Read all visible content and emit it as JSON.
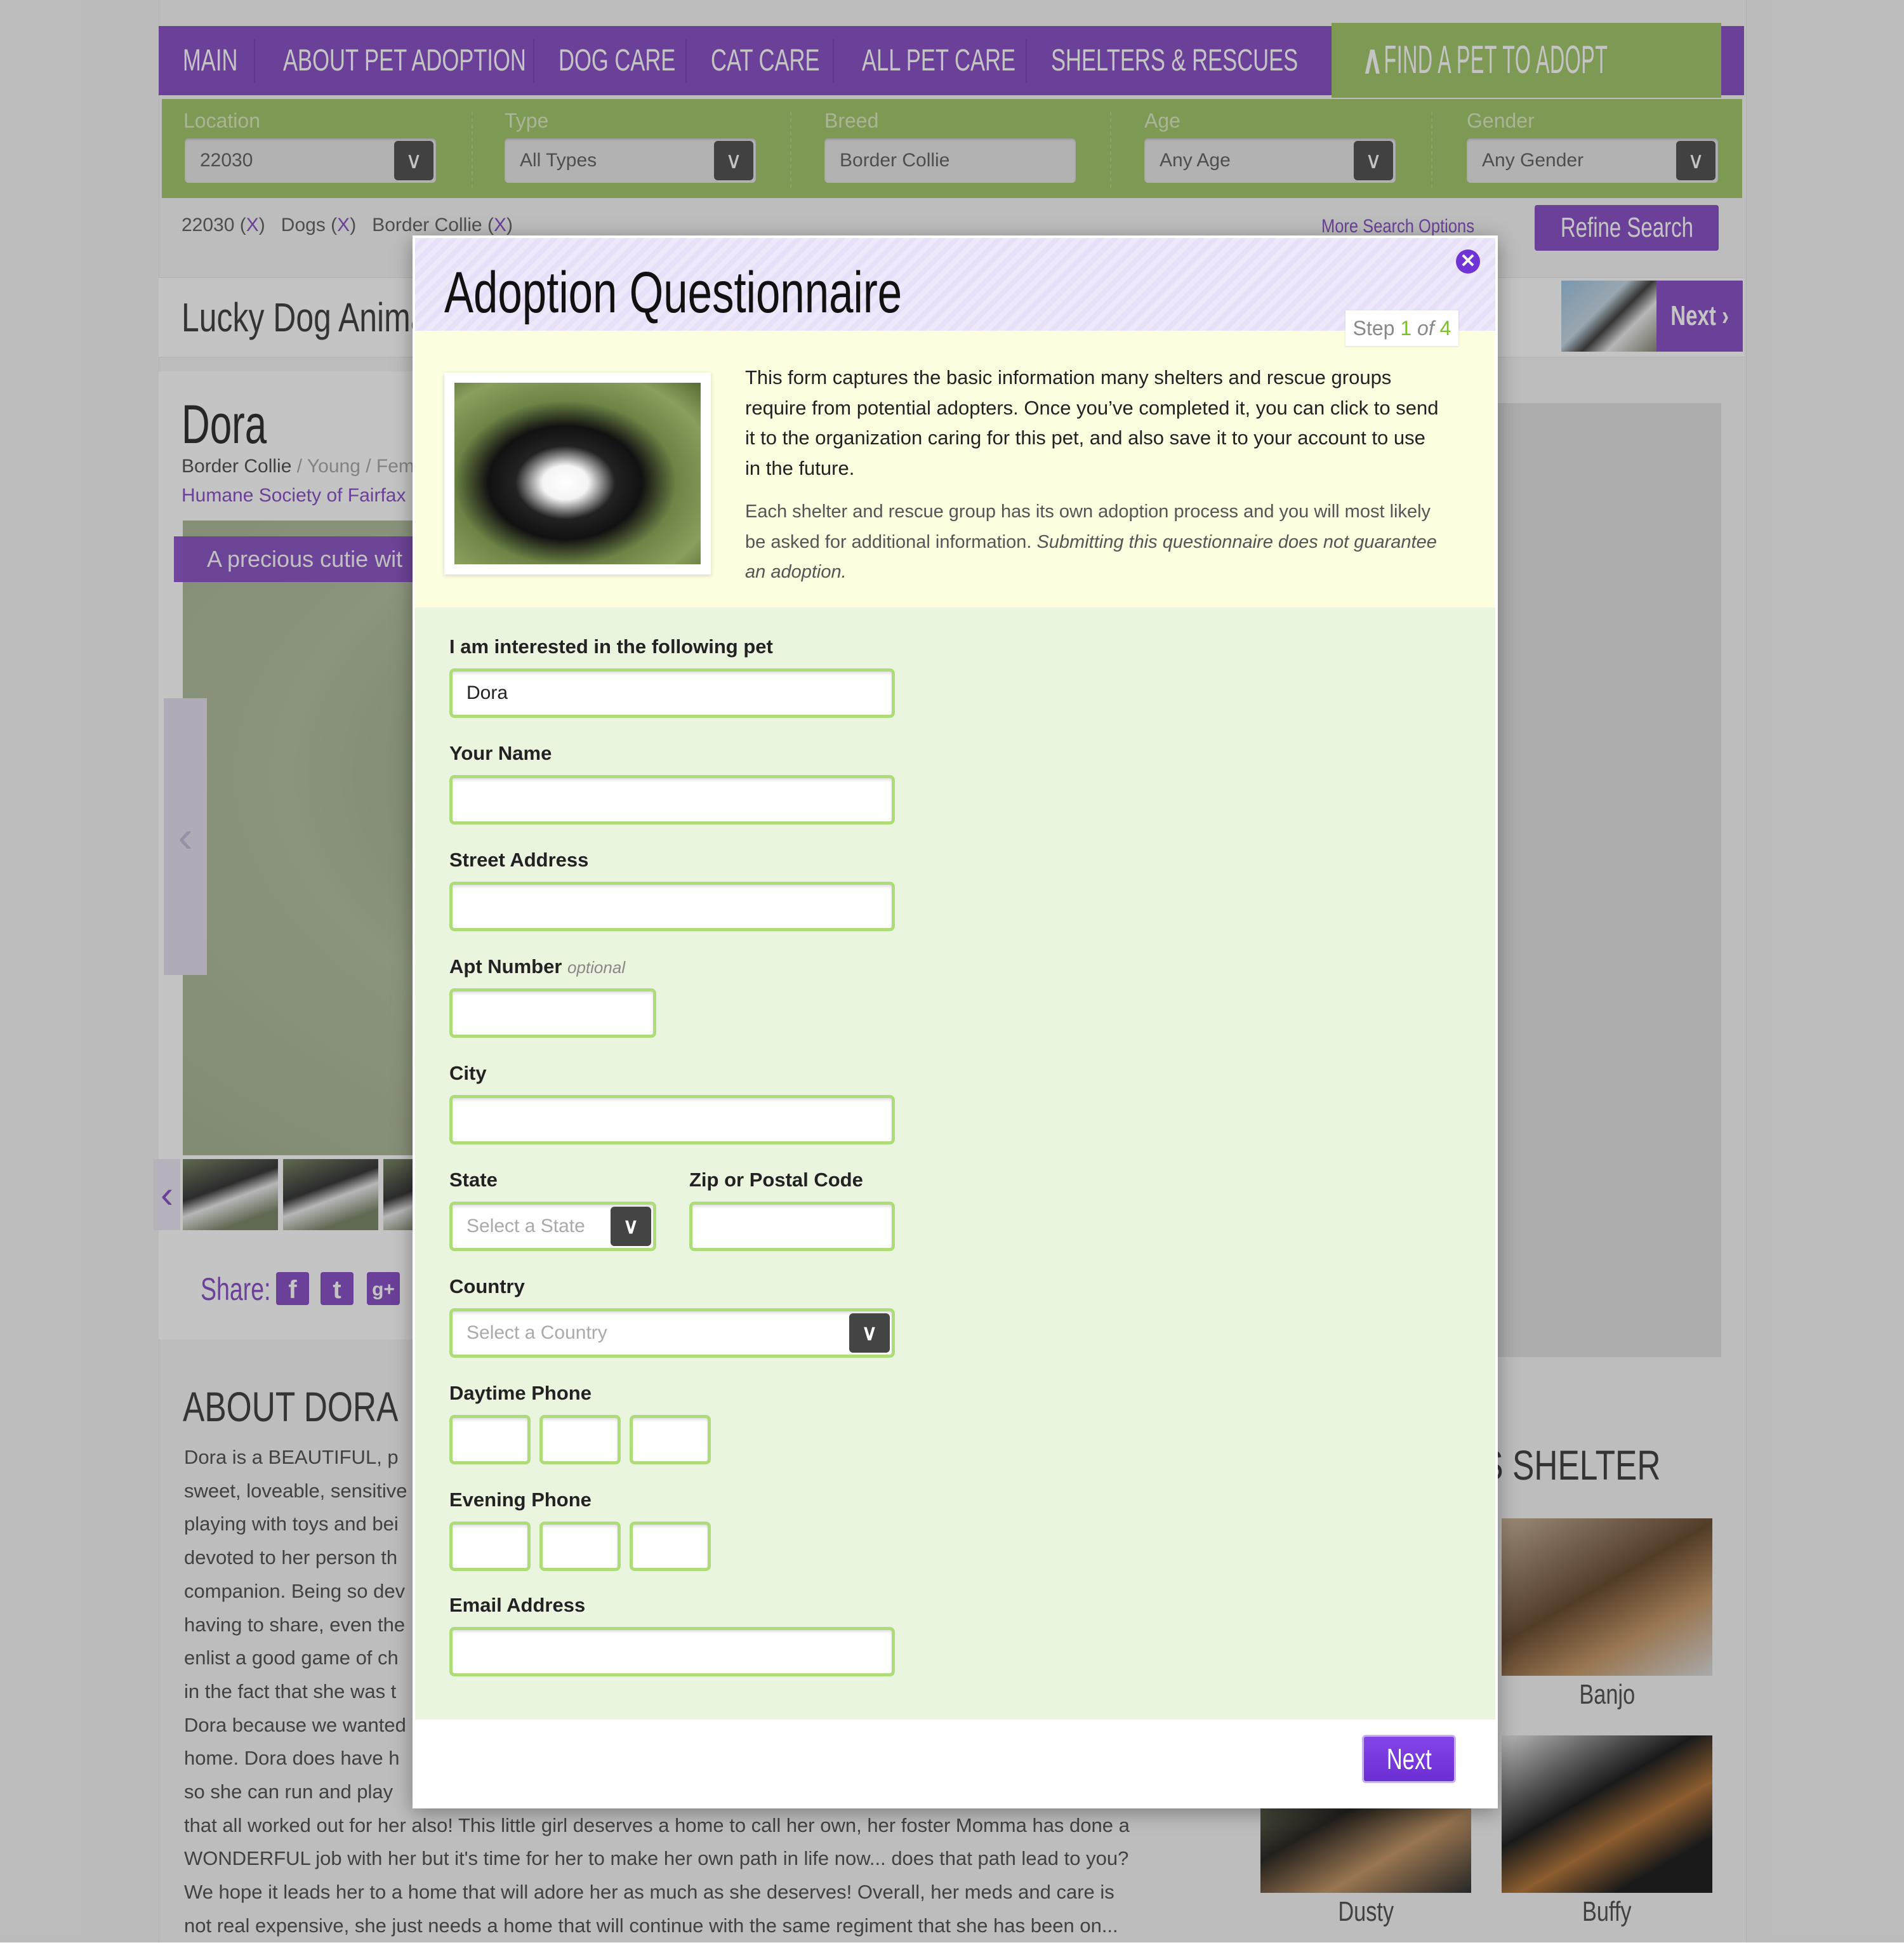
{
  "nav": {
    "items": [
      "MAIN",
      "ABOUT PET ADOPTION",
      "DOG CARE",
      "CAT CARE",
      "ALL PET CARE",
      "SHELTERS & RESCUES"
    ],
    "active_tab": "FIND A PET TO ADOPT",
    "active_tab_icon": "chevron-up-icon"
  },
  "filters": {
    "location": {
      "label": "Location",
      "value": "22030"
    },
    "type": {
      "label": "Type",
      "value": "All Types"
    },
    "breed": {
      "label": "Breed",
      "value": "Border Collie"
    },
    "age": {
      "label": "Age",
      "value": "Any Age"
    },
    "gender": {
      "label": "Gender",
      "value": "Any Gender"
    }
  },
  "applied_filters": [
    {
      "text": "22030",
      "remove": "X"
    },
    {
      "text": "Dogs",
      "remove": "X"
    },
    {
      "text": "Border Collie",
      "remove": "X"
    }
  ],
  "more_search_options": "More Search Options",
  "refine_search": "Refine Search",
  "shelter_bar": {
    "name": "Lucky Dog Animal",
    "next_label": "Next ›"
  },
  "pet": {
    "name": "Dora",
    "breed": "Border Collie",
    "meta": " / Young / Fem",
    "organization": "Humane Society of Fairfax",
    "caption": "A precious cutie wit",
    "share_label": "Share:",
    "share_icons": [
      "f",
      "t",
      "g+"
    ],
    "about_title": "ABOUT DORA",
    "about_lines": [
      "Dora is a BEAUTIFUL, p",
      "sweet, loveable, sensitive",
      "playing with toys and bei",
      "devoted to her person th",
      "companion. Being so dev",
      "having to share, even the",
      "enlist a good game of ch",
      "in the fact that she was t",
      "Dora because we wanted",
      "home. Dora does have h",
      "so she can run and play",
      "that all worked out for her also! This little girl deserves a home to call her own, her foster Momma has done a",
      "WONDERFUL job with her but it's time for her to make her own path in life now... does that path lead to you?",
      "We hope it leads her to a home that will adore her as much as she deserves! Overall, her meds and care is",
      "not real expensive, she just needs a home that will continue with the same regiment that she has been on..."
    ]
  },
  "more_from_shelter": {
    "title": "IS SHELTER",
    "pets": [
      "Banjo",
      "Dusty",
      "Buffy"
    ]
  },
  "modal": {
    "title": "Adoption Questionnaire",
    "close_icon": "close-icon",
    "step": {
      "prefix": "Step",
      "current": "1",
      "of": "of",
      "total": "4"
    },
    "intro_p1": "This form captures the basic information many shelters and rescue groups require from potential adopters. Once you’ve completed it, you can click to send it to the organization caring for this pet, and also save it to your account to use in the future.",
    "intro_p2": "Each shelter and rescue group has its own adoption process and you will most likely be asked for additional information.",
    "intro_p2_italic": "Submitting this questionnaire does not guarantee an adoption.",
    "fields": {
      "pet": {
        "label": "I am interested in the following pet",
        "value": "Dora"
      },
      "name": {
        "label": "Your Name",
        "value": ""
      },
      "street": {
        "label": "Street Address",
        "value": ""
      },
      "apt": {
        "label": "Apt Number",
        "hint": "optional",
        "value": ""
      },
      "city": {
        "label": "City",
        "value": ""
      },
      "state": {
        "label": "State",
        "placeholder": "Select a State"
      },
      "zip": {
        "label": "Zip or Postal Code",
        "value": ""
      },
      "country": {
        "label": "Country",
        "placeholder": "Select a Country"
      },
      "day_phone": {
        "label": "Daytime Phone",
        "values": [
          "",
          "",
          ""
        ]
      },
      "eve_phone": {
        "label": "Evening Phone",
        "values": [
          "",
          "",
          ""
        ]
      },
      "email": {
        "label": "Email Address",
        "value": ""
      }
    },
    "next_button": "Next"
  },
  "colors": {
    "brand_purple": "#8c54c8",
    "accent_green": "#a3c86e",
    "modal_button": "#7034d6",
    "input_border": "#aedc78"
  }
}
